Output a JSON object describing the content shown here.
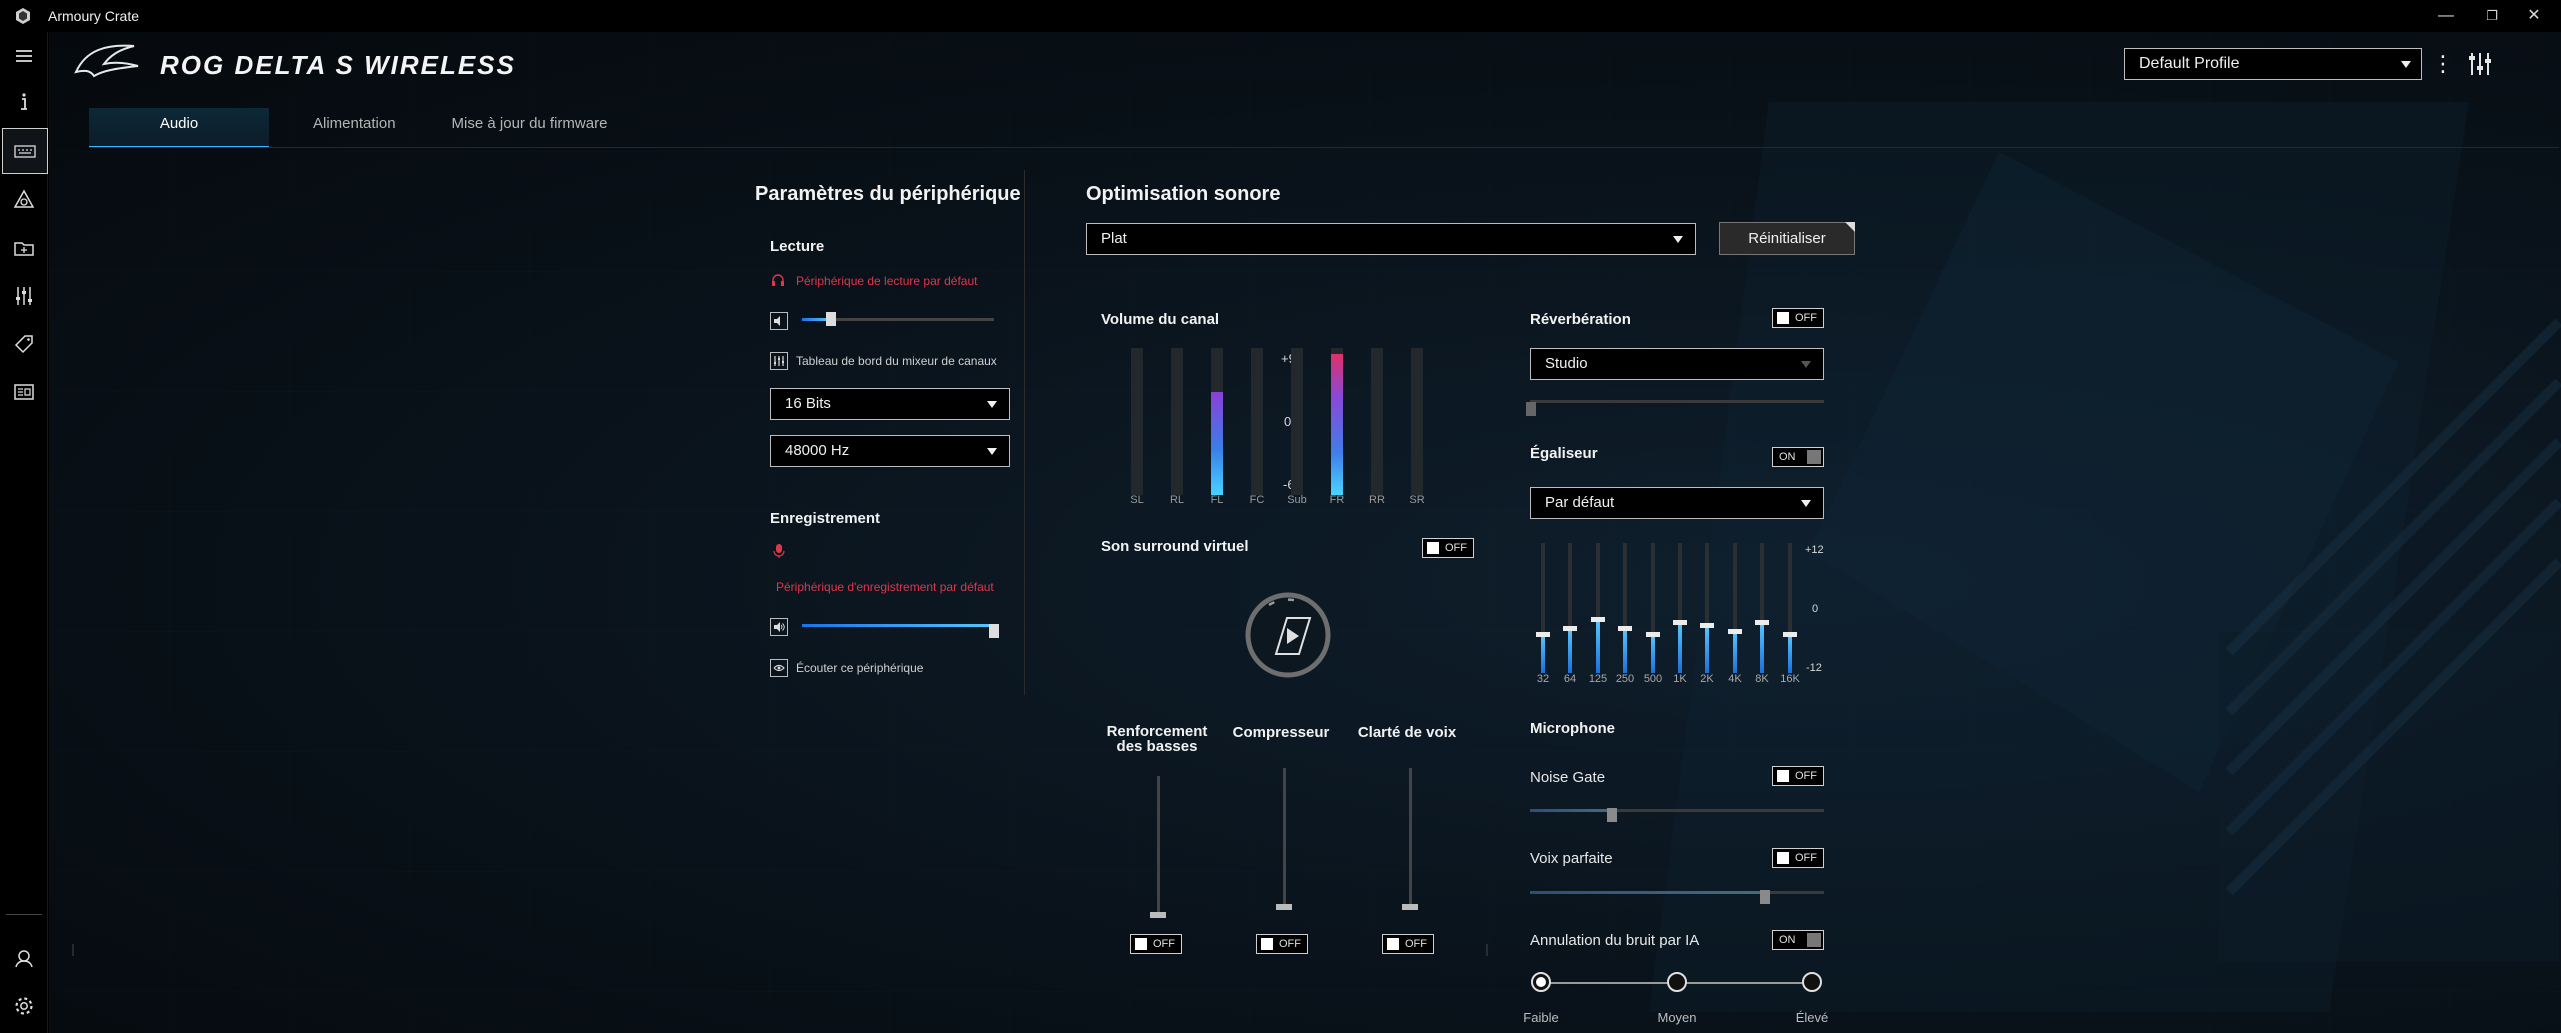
{
  "window": {
    "title": "Armoury Crate",
    "controls": [
      "—",
      "❐",
      "✕"
    ]
  },
  "header": {
    "product": "ROG DELTA S WIRELESS",
    "profile": "Default Profile"
  },
  "tabs": [
    {
      "label": "Audio",
      "active": true
    },
    {
      "label": "Alimentation",
      "active": false
    },
    {
      "label": "Mise à jour du firmware",
      "active": false
    }
  ],
  "device": {
    "title": "Paramètres du périphérique",
    "playback": {
      "title": "Lecture",
      "default_device": "Périphérique de lecture par défaut",
      "volume": 0.15,
      "mixer_label": "Tableau de bord du mixeur de canaux",
      "bit_depth": "16 Bits",
      "sample_rate": "48000 Hz"
    },
    "recording": {
      "title": "Enregistrement",
      "default_device": "Périphérique d'enregistrement par défaut",
      "volume": 1.0,
      "listen_label": "Écouter ce périphérique"
    }
  },
  "sound": {
    "title": "Optimisation sonore",
    "preset": "Plat",
    "reset_label": "Réinitialiser",
    "channel_volume": {
      "title": "Volume du canal",
      "scale": [
        "+9",
        "0",
        "-6"
      ],
      "channels": [
        {
          "label": "SL",
          "level": 0
        },
        {
          "label": "RL",
          "level": 0
        },
        {
          "label": "FL",
          "level": 0.7
        },
        {
          "label": "FC",
          "level": 0
        },
        {
          "label": "Sub",
          "level": 0
        },
        {
          "label": "FR",
          "level": 0.96
        },
        {
          "label": "RR",
          "level": 0
        },
        {
          "label": "SR",
          "level": 0
        }
      ]
    },
    "surround": {
      "title": "Son surround virtuel",
      "state": "OFF"
    },
    "effects": [
      {
        "label": "Renforcement des basses",
        "state": "OFF"
      },
      {
        "label": "Compresseur",
        "state": "OFF"
      },
      {
        "label": "Clarté de voix",
        "state": "OFF"
      }
    ],
    "reverb": {
      "title": "Réverbération",
      "state": "OFF",
      "preset": "Studio"
    },
    "equalizer": {
      "title": "Égaliseur",
      "state": "ON",
      "preset": "Par défaut",
      "scale": [
        "+12",
        "0",
        "-12"
      ],
      "bands": [
        {
          "label": "32",
          "gain": 0
        },
        {
          "label": "64",
          "gain": 2
        },
        {
          "label": "125",
          "gain": 5
        },
        {
          "label": "250",
          "gain": 2
        },
        {
          "label": "500",
          "gain": 0
        },
        {
          "label": "1K",
          "gain": 4
        },
        {
          "label": "2K",
          "gain": 3
        },
        {
          "label": "4K",
          "gain": 1
        },
        {
          "label": "8K",
          "gain": 4
        },
        {
          "label": "16K",
          "gain": 0
        }
      ]
    },
    "microphone": {
      "title": "Microphone",
      "noise_gate": {
        "label": "Noise Gate",
        "state": "OFF",
        "level": 0.28
      },
      "perfect_voice": {
        "label": "Voix parfaite",
        "state": "OFF",
        "level": 0.8
      },
      "ai_noise": {
        "label": "Annulation du bruit par IA",
        "state": "ON",
        "levels": [
          "Faible",
          "Moyen",
          "Élevé"
        ],
        "selected": 0
      }
    }
  }
}
